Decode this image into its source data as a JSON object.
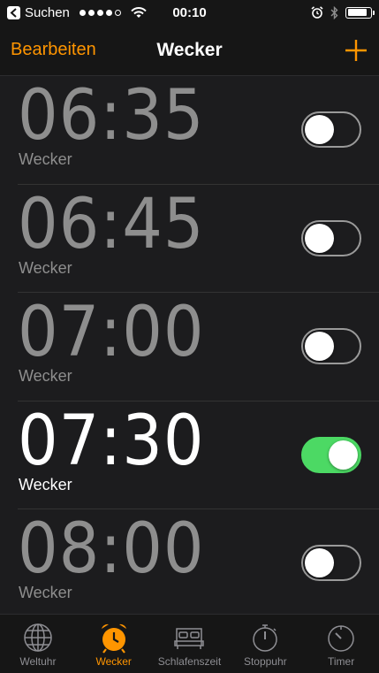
{
  "status_bar": {
    "back_label": "Suchen",
    "time": "00:10",
    "signal_filled": 4,
    "battery_level": 0.85
  },
  "nav": {
    "edit_label": "Bearbeiten",
    "title": "Wecker",
    "add_icon": "plus-icon"
  },
  "alarms": [
    {
      "time": "06:35",
      "label": "Wecker",
      "enabled": false
    },
    {
      "time": "06:45",
      "label": "Wecker",
      "enabled": false
    },
    {
      "time": "07:00",
      "label": "Wecker",
      "enabled": false
    },
    {
      "time": "07:30",
      "label": "Wecker",
      "enabled": true
    },
    {
      "time": "08:00",
      "label": "Wecker",
      "enabled": false
    }
  ],
  "tabs": [
    {
      "label": "Weltuhr",
      "icon": "globe-icon",
      "active": false
    },
    {
      "label": "Wecker",
      "icon": "alarm-clock-icon",
      "active": true
    },
    {
      "label": "Schlafenszeit",
      "icon": "bed-icon",
      "active": false
    },
    {
      "label": "Stoppuhr",
      "icon": "stopwatch-icon",
      "active": false
    },
    {
      "label": "Timer",
      "icon": "timer-icon",
      "active": false
    }
  ],
  "colors": {
    "accent": "#ff9500",
    "toggle_on": "#4cd964",
    "inactive_text": "#8e8e8e"
  }
}
